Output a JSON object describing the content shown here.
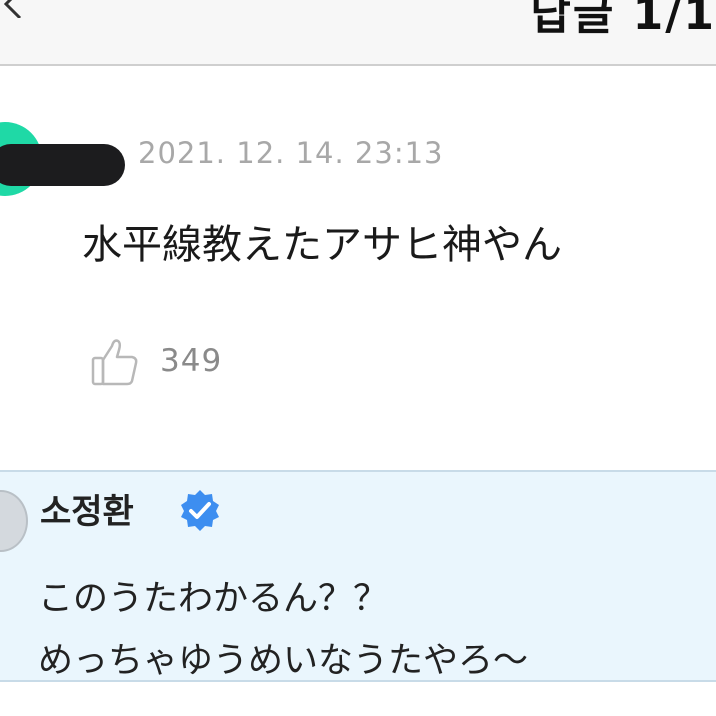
{
  "header": {
    "title": "답글 1/1",
    "back_icon": "chevron-left-icon"
  },
  "comment": {
    "timestamp": "2021. 12. 14. 23:13",
    "text": "水平線教えたアサヒ神やん",
    "likes": "349",
    "like_icon": "thumbs-up-icon",
    "avatar_color": "#1fd9a6"
  },
  "reply": {
    "author": "소정환",
    "verified_icon": "verified-badge-icon",
    "verified_color": "#3d8ef0",
    "lines": [
      "このうたわかるん？？",
      "めっちゃゆうめいなうたやろ～"
    ],
    "background": "#eaf6fd"
  }
}
